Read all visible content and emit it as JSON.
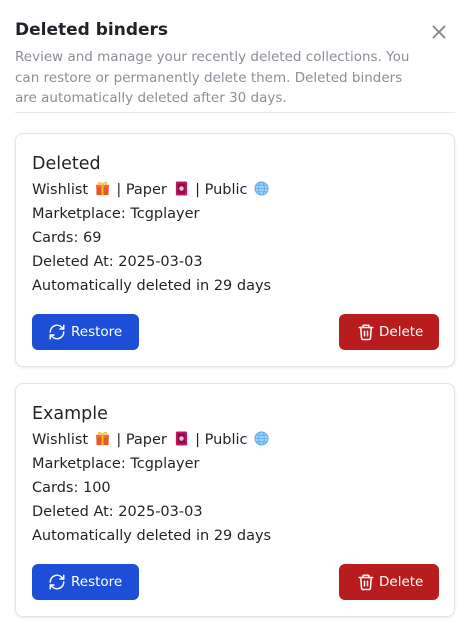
{
  "dialog": {
    "title": "Deleted binders",
    "description": "Review and manage your recently deleted collections. You can restore or permanently delete them. Deleted binders are automatically deleted after 30 days.",
    "close_icon": "close-icon"
  },
  "binders": [
    {
      "name": "Deleted",
      "type": "Wishlist",
      "type_icon": "gift-icon",
      "format": "Paper",
      "format_icon": "card-icon",
      "visibility": "Public",
      "visibility_icon": "globe-icon",
      "separator": "|",
      "marketplace": "Marketplace: Tcgplayer",
      "cards": "Cards: 69",
      "deleted_at": "Deleted At: 2025-03-03",
      "auto_delete": "Automatically deleted in 29 days",
      "restore_label": "Restore",
      "delete_label": "Delete"
    },
    {
      "name": "Example",
      "type": "Wishlist",
      "type_icon": "gift-icon",
      "format": "Paper",
      "format_icon": "card-icon",
      "visibility": "Public",
      "visibility_icon": "globe-icon",
      "separator": "|",
      "marketplace": "Marketplace: Tcgplayer",
      "cards": "Cards: 100",
      "deleted_at": "Deleted At: 2025-03-03",
      "auto_delete": "Automatically deleted in 29 days",
      "restore_label": "Restore",
      "delete_label": "Delete"
    }
  ],
  "colors": {
    "restore": "#1d4ed8",
    "delete": "#b91c1c",
    "muted_text": "#8a8f98"
  }
}
